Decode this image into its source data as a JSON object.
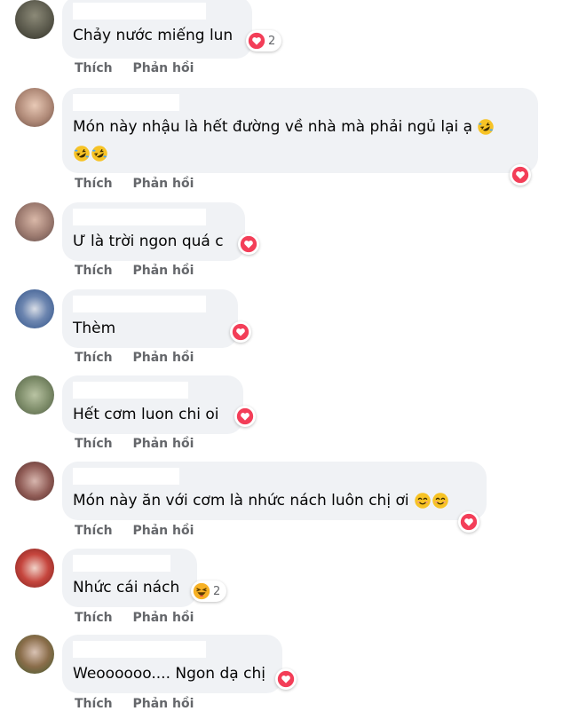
{
  "actions": {
    "like": "Thích",
    "reply": "Phản hồi"
  },
  "colors": {
    "bubble": "#f0f2f5",
    "heart": "#f33e58",
    "action_text": "#65676b",
    "haha": "#f7b125"
  },
  "comments": [
    {
      "text": "Chảy nước miếng lun",
      "reaction": "heart-icon",
      "count": "2"
    },
    {
      "text_line1": "Món này nhậu là hết đường về nhà mà phải ngủ lại ạ",
      "emoji_line1": "rofl-emoji",
      "emoji_line2": [
        "rofl-emoji",
        "rofl-emoji"
      ],
      "reaction": "heart-icon"
    },
    {
      "text": "Ư là trời ngon quá c",
      "reaction": "heart-icon"
    },
    {
      "text": "Thèm",
      "reaction": "heart-icon"
    },
    {
      "text": "Hết cơm luon chi oi",
      "reaction": "heart-icon"
    },
    {
      "text": "Món này ăn với cơm là nhức nách luôn chị ơi",
      "emojis": [
        "smiling-emoji",
        "smiling-emoji"
      ],
      "reaction": "heart-icon"
    },
    {
      "text": "Nhức cái nách",
      "reaction": "haha-icon",
      "count": "2"
    },
    {
      "text": "Weoooooo.... Ngon dạ chị",
      "reaction": "heart-icon"
    }
  ]
}
